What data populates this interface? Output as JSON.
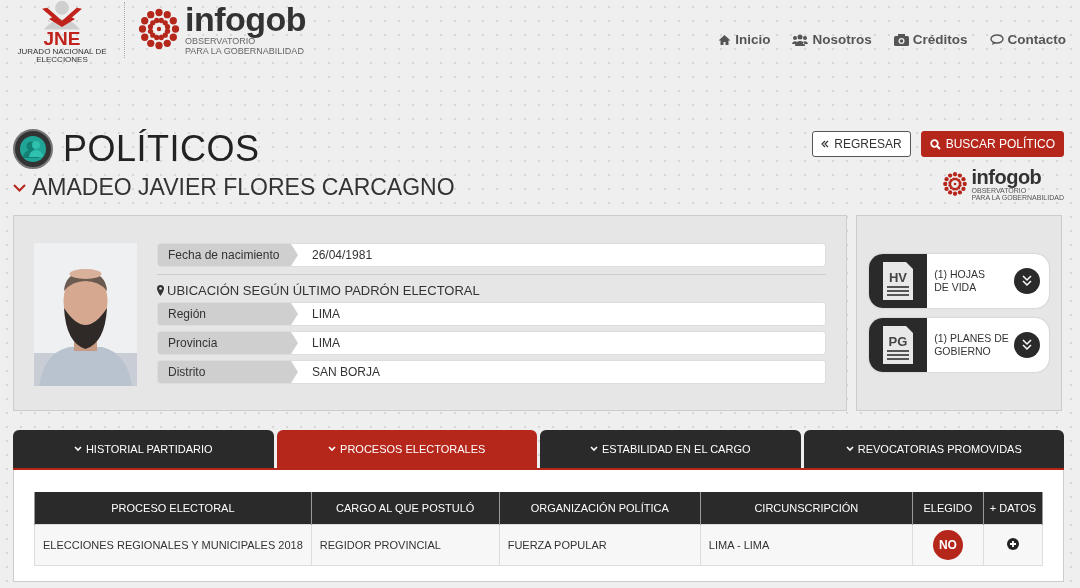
{
  "header": {
    "jne": {
      "name": "JNE",
      "subtitle": "JURADO NACIONAL DE ELECCIONES"
    },
    "brand": {
      "name": "infogob",
      "line1": "OBSERVATORIO",
      "line2": "PARA LA GOBERNABILIDAD"
    }
  },
  "nav": [
    {
      "label": "Inicio",
      "kind": "home"
    },
    {
      "label": "Nosotros",
      "kind": "users"
    },
    {
      "label": "Créditos",
      "kind": "camera"
    },
    {
      "label": "Contacto",
      "kind": "chat"
    }
  ],
  "page_title": "POLÍTICOS",
  "actions": [
    {
      "label": "REGRESAR",
      "kind": "outline"
    },
    {
      "label": "BUSCAR POLÍTICO",
      "kind": "primary"
    }
  ],
  "person": {
    "name": "AMADEO JAVIER FLORES CARCAGNO",
    "birth": {
      "label": "Fecha de nacimiento",
      "value": "26/04/1981"
    },
    "location_title": "UBICACIÓN SEGÚN ÚLTIMO PADRÓN ELECTORAL",
    "location": [
      {
        "label": "Región",
        "value": "LIMA"
      },
      {
        "label": "Provincia",
        "value": "LIMA"
      },
      {
        "label": "Distrito",
        "value": "SAN BORJA"
      }
    ]
  },
  "side_logo": {
    "name": "infogob",
    "line1": "OBSERVATORIO",
    "line2": "PARA LA GOBERNABILIDAD"
  },
  "documents": [
    {
      "code": "HV",
      "line1": "(1) HOJAS",
      "line2": "DE VIDA"
    },
    {
      "code": "PG",
      "line1": "(1) PLANES DE",
      "line2": "GOBIERNO"
    }
  ],
  "tabs": [
    {
      "label": "HISTORIAL PARTIDARIO",
      "selected": false
    },
    {
      "label": "PROCESOS ELECTORALES",
      "selected": true
    },
    {
      "label": "ESTABILIDAD EN EL CARGO",
      "selected": false
    },
    {
      "label": "REVOCATORIAS PROMOVIDAS",
      "selected": false
    }
  ],
  "table": {
    "columns": [
      "PROCESO ELECTORAL",
      "CARGO AL QUE POSTULÓ",
      "ORGANIZACIÓN POLÍTICA",
      "CIRCUNSCRIPCIÓN",
      "ELEGIDO",
      "+ DATOS"
    ],
    "rows": [
      {
        "cells": [
          "ELECCIONES REGIONALES Y MUNICIPALES 2018",
          "REGIDOR PROVINCIAL",
          "FUERZA POPULAR",
          "LIMA - LIMA"
        ],
        "elected": false,
        "elected_label": "NO"
      }
    ]
  }
}
